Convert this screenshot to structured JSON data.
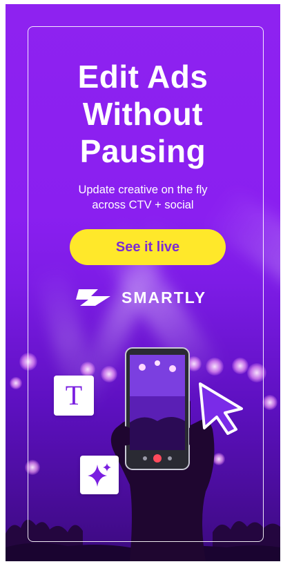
{
  "ad": {
    "headline": [
      "Edit Ads",
      "Without",
      "Pausing"
    ],
    "subtitle": [
      "Update creative on the fly",
      "across CTV + social"
    ],
    "cta_label": "See it live",
    "brand": "SMARTLY",
    "text_tile_glyph": "T"
  },
  "icons": {
    "logo": "bolt-logo-icon",
    "text_tile": "text-format-icon",
    "sparkle_tile": "sparkle-icon",
    "cursor": "pointer-cursor-icon",
    "phone": "smartphone-icon"
  },
  "colors": {
    "background": "#8a1ff0",
    "cta_background": "#ffe82a",
    "cta_text": "#7b2bd4",
    "frame": "#ffffff",
    "accent": "#7a1fe0"
  }
}
